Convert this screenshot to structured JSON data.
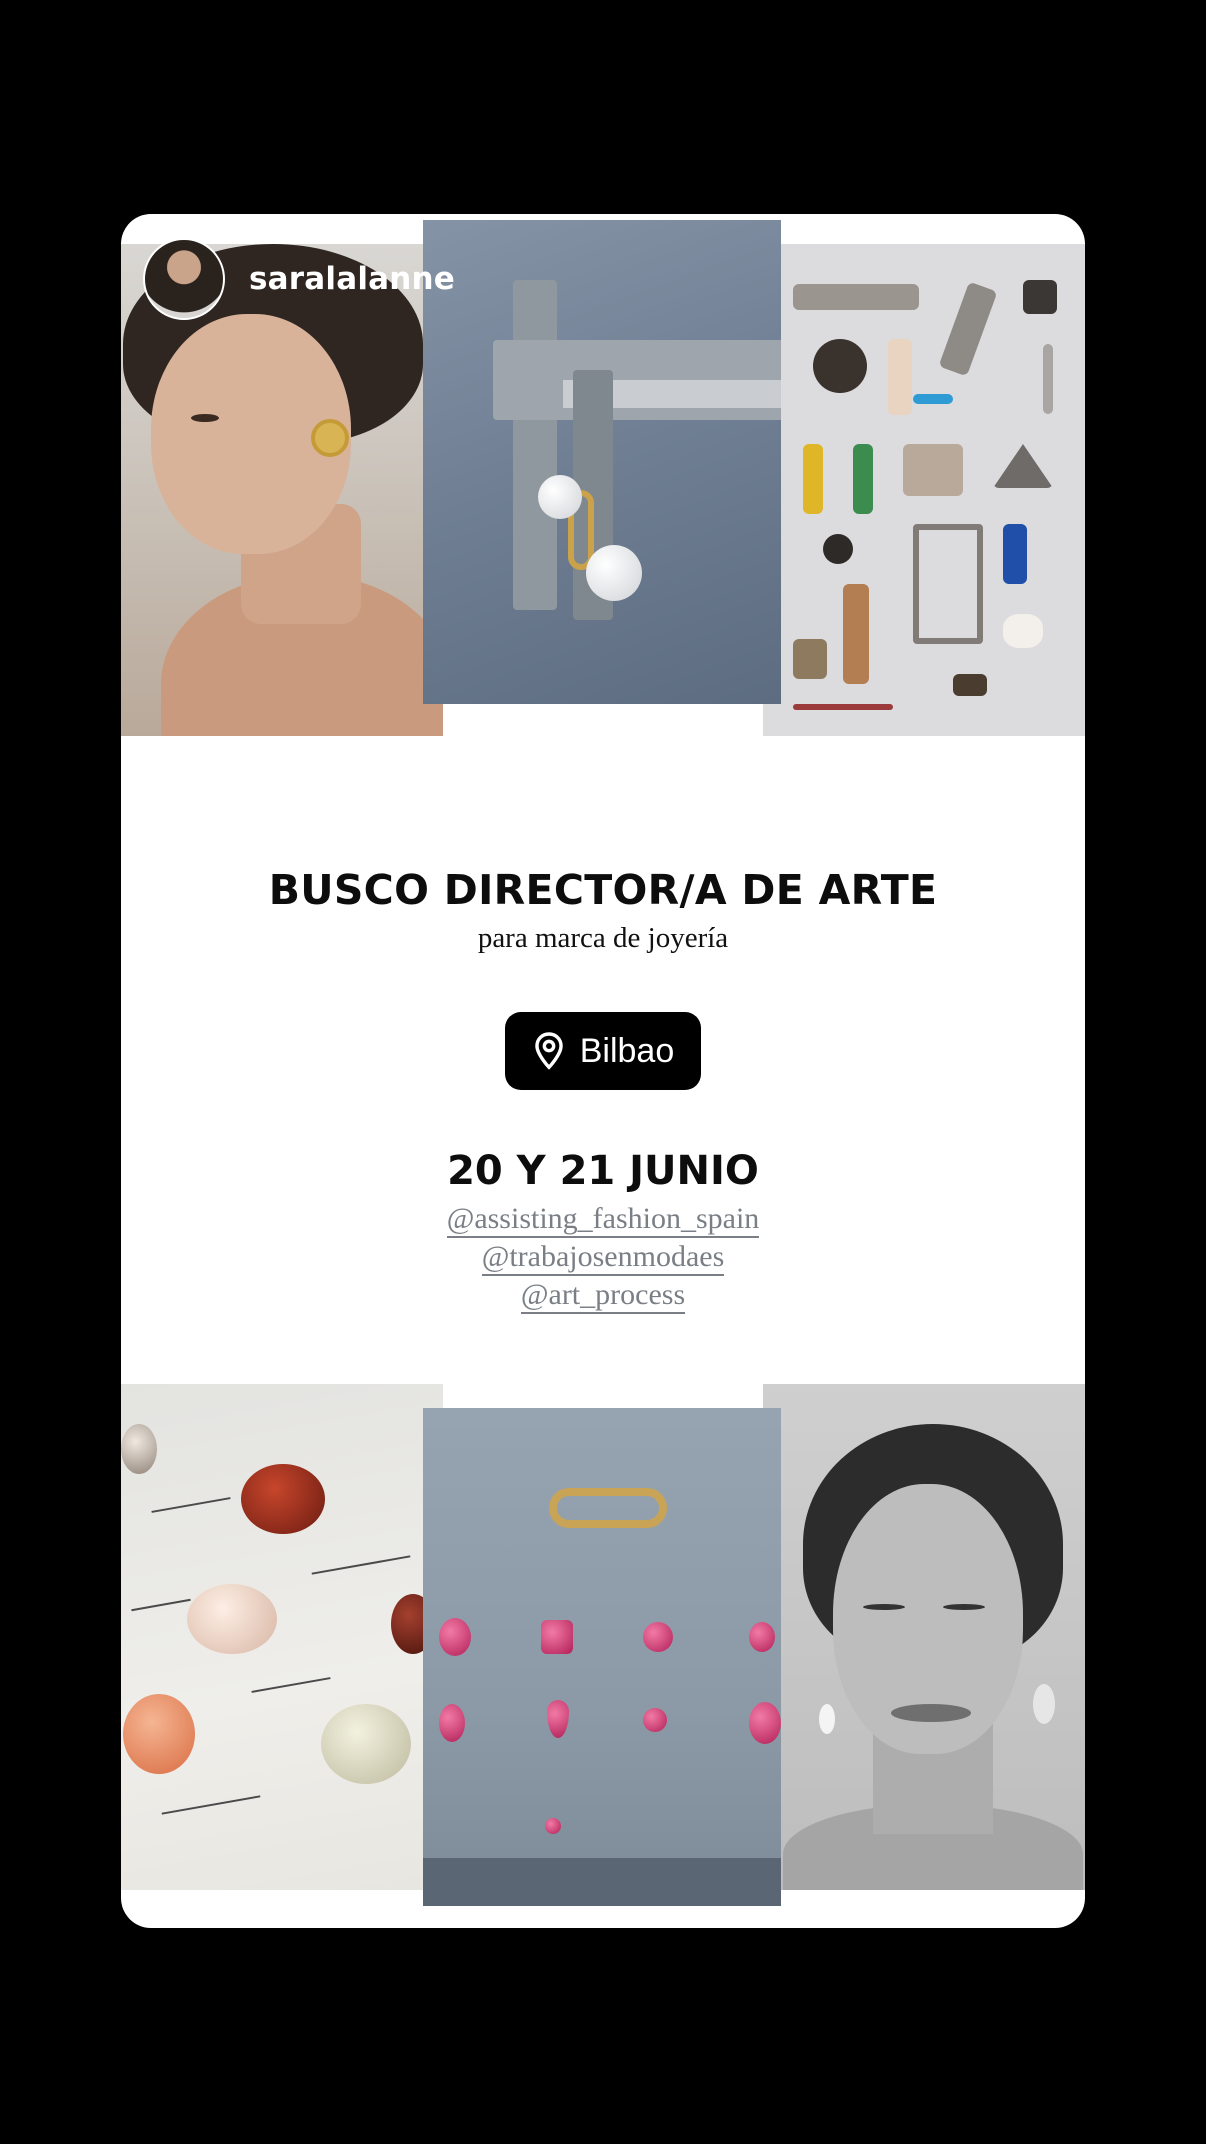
{
  "story": {
    "username": "saralalanne",
    "title": "BUSCO DIRECTOR/A DE ARTE",
    "subtitle": "para marca de joyería",
    "location": {
      "icon": "map-pin-icon",
      "label": "Bilbao"
    },
    "dates": "20 Y 21 JUNIO",
    "mentions": [
      "@assisting_fashion_spain",
      "@trabajosenmodaes",
      "@art_process"
    ]
  },
  "colors": {
    "background": "#000000",
    "card": "#ffffff",
    "text": "#0d0d0d",
    "mention": "#7a7f86",
    "pill": "#000000"
  }
}
